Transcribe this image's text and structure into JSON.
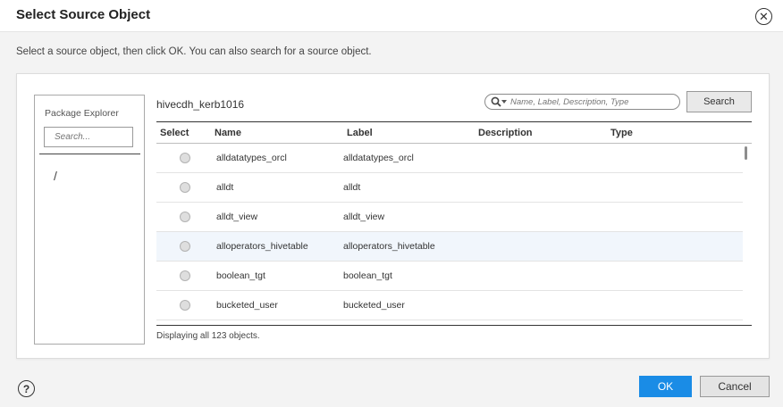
{
  "dialog": {
    "title": "Select Source Object",
    "close_icon": "close-circle-icon",
    "instructions": "Select a source object, then click OK. You can also search for a source object."
  },
  "package_explorer": {
    "title": "Package Explorer",
    "search_placeholder": "Search...",
    "root": "/"
  },
  "main": {
    "connection_name": "hivecdh_kerb1016",
    "search": {
      "placeholder": "Name, Label, Description, Type",
      "button_label": "Search",
      "icon": "search-icon"
    },
    "columns": {
      "select": "Select",
      "name": "Name",
      "label": "Label",
      "description": "Description",
      "type": "Type"
    },
    "rows": [
      {
        "name": "alldatatypes_orcl",
        "label": "alldatatypes_orcl"
      },
      {
        "name": "alldt",
        "label": "alldt"
      },
      {
        "name": "alldt_view",
        "label": "alldt_view"
      },
      {
        "name": "alloperators_hivetable",
        "label": "alloperators_hivetable"
      },
      {
        "name": "boolean_tgt",
        "label": "boolean_tgt"
      },
      {
        "name": "bucketed_user",
        "label": "bucketed_user"
      }
    ],
    "highlighted_row_index": 3,
    "count_text": "Displaying all 123 objects."
  },
  "footer": {
    "help_icon": "help-circle-icon",
    "help_glyph": "?",
    "ok_label": "OK",
    "cancel_label": "Cancel"
  },
  "colors": {
    "primary_button": "#1a8ce6",
    "row_highlight": "#f1f6fc"
  }
}
